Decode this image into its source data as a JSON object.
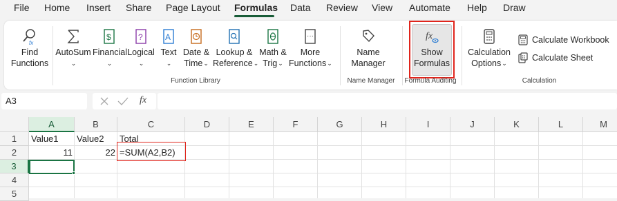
{
  "menu": {
    "items": [
      "File",
      "Home",
      "Insert",
      "Share",
      "Page Layout",
      "Formulas",
      "Data",
      "Review",
      "View",
      "Automate",
      "Help",
      "Draw"
    ],
    "active": "Formulas"
  },
  "ribbon": {
    "find_functions": [
      "Find",
      "Functions"
    ],
    "autosum": "AutoSum",
    "financial": "Financial",
    "logical": "Logical",
    "text": "Text",
    "date_time": [
      "Date &",
      "Time"
    ],
    "lookup_reference": [
      "Lookup &",
      "Reference"
    ],
    "math_trig": [
      "Math &",
      "Trig"
    ],
    "more_functions": [
      "More",
      "Functions"
    ],
    "group_function_library": "Function Library",
    "name_manager": [
      "Name",
      "Manager"
    ],
    "group_name_manager": "Name Manager",
    "show_formulas": [
      "Show",
      "Formulas"
    ],
    "group_formula_auditing": "Formula Auditing",
    "calculation_options": [
      "Calculation",
      "Options"
    ],
    "calculate_workbook": "Calculate Workbook",
    "calculate_sheet": "Calculate Sheet",
    "group_calculation": "Calculation"
  },
  "formula_bar": {
    "name_box": "A3",
    "fx_label": "fx",
    "content": ""
  },
  "sheet": {
    "columns": [
      "A",
      "B",
      "C",
      "D",
      "E",
      "F",
      "G",
      "H",
      "I",
      "J",
      "K",
      "L",
      "M"
    ],
    "rows": [
      "1",
      "2",
      "3",
      "4",
      "5"
    ],
    "cells": {
      "A1": "Value1",
      "B1": "Value2",
      "C1": "Total",
      "A2": "11",
      "B2": "22",
      "C2": "=SUM(A2,B2)"
    },
    "active_cell": "A3"
  },
  "colors": {
    "accent_green": "#1a7443",
    "highlight_red": "#e0241b"
  }
}
